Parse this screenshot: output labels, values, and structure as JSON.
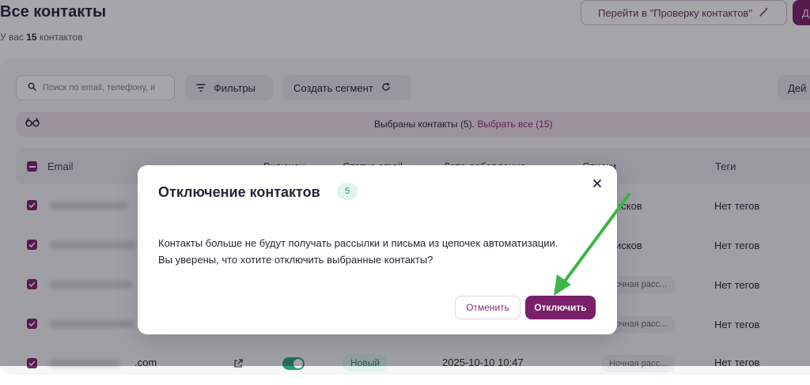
{
  "page": {
    "title": "Все контакты",
    "count_prefix": "У вас",
    "count_value": "15",
    "count_suffix": "контактов",
    "go_check_button": "Перейти в \"Проверку контактов\"",
    "add_button_partial": "Д"
  },
  "toolbar": {
    "search_placeholder": "Поиск по email, телефону, и",
    "filters_label": "Фильтры",
    "segment_label": "Создать сегмент",
    "actions_partial": "Дей"
  },
  "selection_bar": {
    "selected_text": "Выбраны контакты (5).",
    "select_all_text": "Выбрать все (15)"
  },
  "table": {
    "columns": [
      "Email",
      "Включен",
      "Статус email",
      "Дата добавления",
      "Списки",
      "Теги"
    ],
    "rows": [
      {
        "list": "исков",
        "tags": "Нет тегов"
      },
      {
        "list": "исков",
        "tags": "Нет тегов"
      },
      {
        "list": "Ночная расс...",
        "tags": "Нет тегов"
      },
      {
        "list": "Ночная расс...",
        "tags": "Нет тегов"
      },
      {
        "email_suffix": ".com",
        "status": "Новый",
        "date": "2025-10-10 10:47",
        "list": "Ночная расс...",
        "tags": "Нет тегов"
      }
    ]
  },
  "modal": {
    "title": "Отключение контактов",
    "badge": "5",
    "line1": "Контакты больше не будут получать рассылки и письма из цепочек автоматизации.",
    "line2": "Вы уверены, что хотите отключить выбранные контакты?",
    "cancel_label": "Отменить",
    "confirm_label": "Отключить"
  },
  "colors": {
    "brand": "#7b1f6a",
    "annotation_arrow": "#3bb54a",
    "status_green": "#2f8a67"
  }
}
